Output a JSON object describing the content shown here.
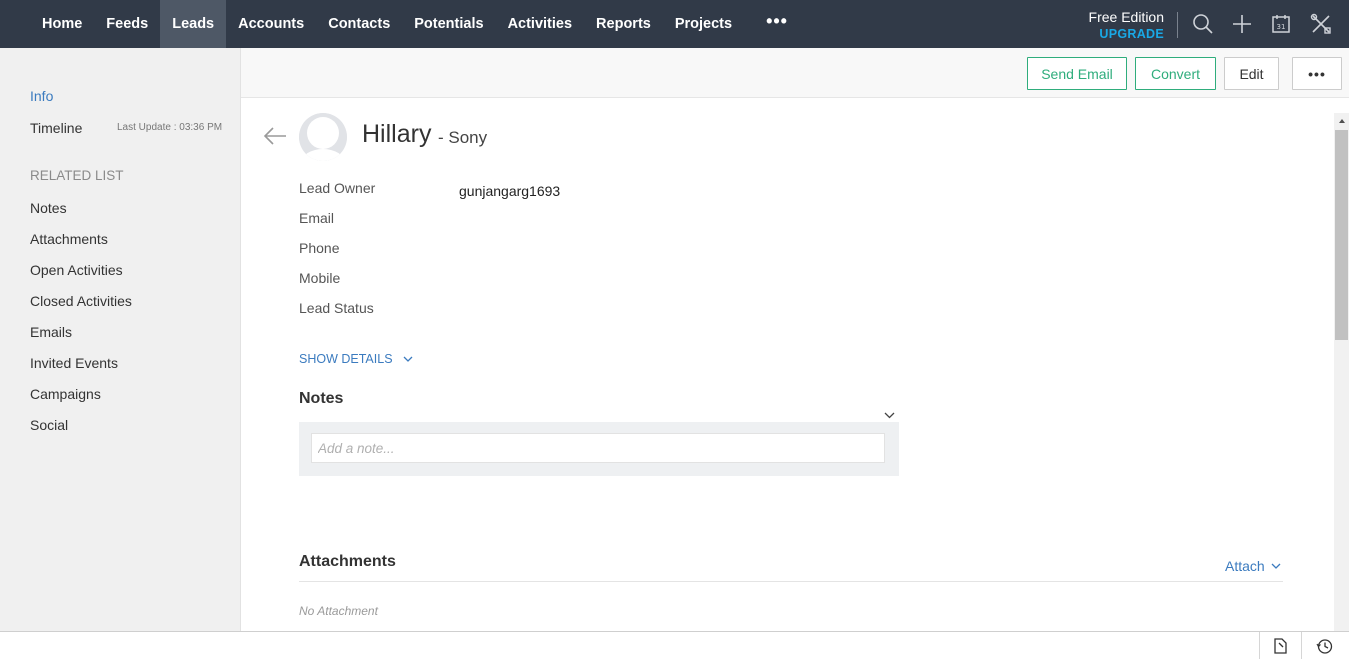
{
  "nav": {
    "items": [
      {
        "label": "Home",
        "active": false
      },
      {
        "label": "Feeds",
        "active": false
      },
      {
        "label": "Leads",
        "active": true
      },
      {
        "label": "Accounts",
        "active": false
      },
      {
        "label": "Contacts",
        "active": false
      },
      {
        "label": "Potentials",
        "active": false
      },
      {
        "label": "Activities",
        "active": false
      },
      {
        "label": "Reports",
        "active": false
      },
      {
        "label": "Projects",
        "active": false
      }
    ],
    "more_label": "•••",
    "edition_label": "Free Edition",
    "upgrade_label": "UPGRADE",
    "icons": [
      "search-icon",
      "plus-icon",
      "calendar-icon",
      "tools-icon"
    ],
    "calendar_day": "31"
  },
  "sidebar": {
    "info_label": "Info",
    "timeline_label": "Timeline",
    "last_update": "Last Update : 03:36 PM",
    "related_heading": "RELATED LIST",
    "related_items": [
      "Notes",
      "Attachments",
      "Open Activities",
      "Closed Activities",
      "Emails",
      "Invited Events",
      "Campaigns",
      "Social"
    ]
  },
  "actions": {
    "send_email": "Send Email",
    "convert": "Convert",
    "edit": "Edit",
    "more": "•••"
  },
  "record": {
    "name": "Hillary",
    "company": "- Sony",
    "fields": [
      {
        "label": "Lead Owner",
        "value": "gunjangarg1693"
      },
      {
        "label": "Email",
        "value": ""
      },
      {
        "label": "Phone",
        "value": ""
      },
      {
        "label": "Mobile",
        "value": ""
      },
      {
        "label": "Lead Status",
        "value": ""
      }
    ],
    "show_details": "SHOW DETAILS"
  },
  "notes": {
    "title": "Notes",
    "placeholder": "Add a note..."
  },
  "attachments": {
    "title": "Attachments",
    "attach_link": "Attach",
    "empty_text": "No Attachment"
  },
  "colors": {
    "nav_bg": "#313a48",
    "nav_active": "#4e5866",
    "accent_blue": "#3b7bbf",
    "upgrade_blue": "#19a9e6",
    "green": "#2fad7c"
  }
}
